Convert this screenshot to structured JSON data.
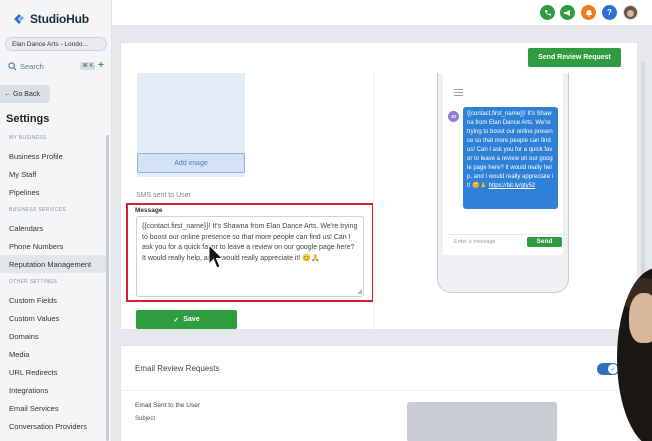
{
  "app": {
    "brand": "StudioHub",
    "location": "Elan Dance Arts - Londo...",
    "search_placeholder": "Search",
    "search_shortcut": "⌘ K",
    "go_back": "Go Back",
    "settings_title": "Settings"
  },
  "sidebar": {
    "section_business": "MY BUSINESS",
    "section_services": "BUSINESS SERVICES",
    "section_other": "OTHER SETTINGS",
    "items": [
      {
        "label": "Business Profile"
      },
      {
        "label": "My Staff"
      },
      {
        "label": "Pipelines"
      },
      {
        "label": "Calendars"
      },
      {
        "label": "Phone Numbers"
      },
      {
        "label": "Reputation Management"
      },
      {
        "label": "Custom Fields"
      },
      {
        "label": "Custom Values"
      },
      {
        "label": "Domains"
      },
      {
        "label": "Media"
      },
      {
        "label": "URL Redirects"
      },
      {
        "label": "Integrations"
      },
      {
        "label": "Email Services"
      },
      {
        "label": "Conversation Providers"
      }
    ]
  },
  "topbar": {
    "icons": [
      {
        "name": "phone-icon",
        "color": "#2e9c3f"
      },
      {
        "name": "megaphone-icon",
        "color": "#2e9c3f"
      },
      {
        "name": "bell-icon",
        "color": "#f07a1a"
      },
      {
        "name": "help-icon",
        "color": "#2f6fd1"
      }
    ],
    "help_glyph": "?"
  },
  "sms": {
    "send_review_button": "Send Review Request",
    "add_image": "Add image",
    "sms_label": "SMS sent to User",
    "message_label": "Message",
    "message_text": "{{contact.first_name}}! It's Shawna from Elan Dance Arts. We're trying to boost our online presence so that more people can find us! Can I ask you for a quick favor to leave a review on our google page here? It would really help, and I would really appreciate it! 😊🙏",
    "save_button": "Save"
  },
  "preview": {
    "avatar_initials": "JD",
    "bubble_text": "{{contact.first_name}}! It's Shawna from Elan Dance Arts. We're trying to boost our online presence so that more people can find us! Can I ask you for a quick favor to leave a review on our google page here? It would really help, and I would really appreciate it! 😊🙏 ",
    "bubble_link": "https://bit.ly/gty52",
    "input_placeholder": "Enter a message",
    "send_label": "Send"
  },
  "email": {
    "title": "Email Review Requests",
    "toggle_on": true,
    "sent_label": "Email Sent to the User",
    "subject_label": "Subject"
  },
  "colors": {
    "accent_green": "#2e9c3f",
    "highlight_red": "#d4202e",
    "bubble_blue": "#2f80d7"
  }
}
